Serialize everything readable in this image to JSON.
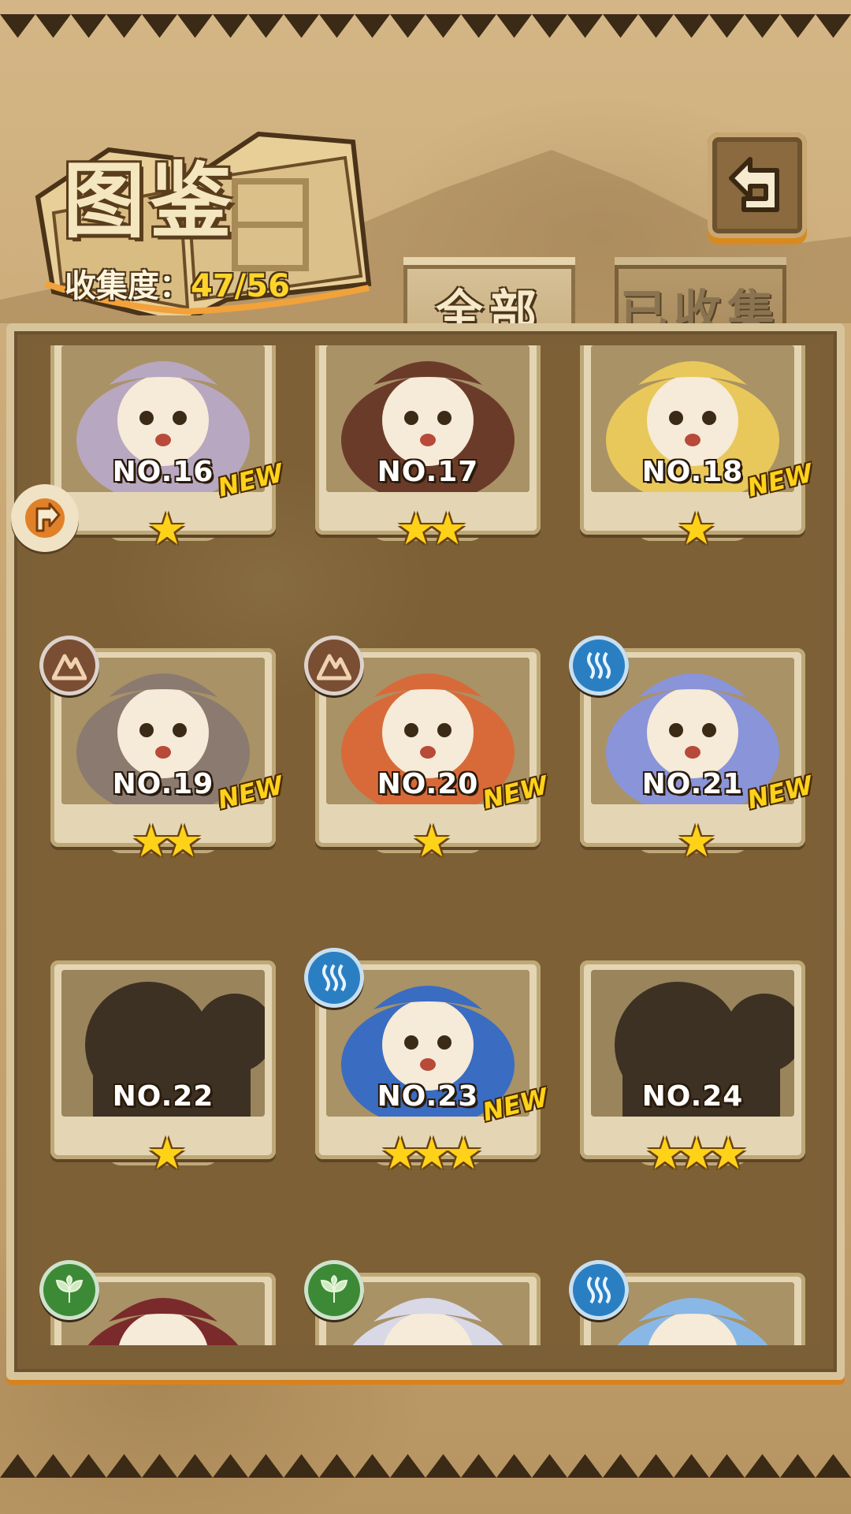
{
  "header": {
    "title": "图鉴",
    "collection_label": "收集度：",
    "collection_count": "47/56"
  },
  "tabs": [
    {
      "label": "全部",
      "active": true
    },
    {
      "label": "已收集",
      "active": false
    }
  ],
  "cards": [
    {
      "no": "NO.16",
      "stars": 1,
      "new": true,
      "element": null
    },
    {
      "no": "NO.17",
      "stars": 2,
      "new": false,
      "element": null
    },
    {
      "no": "NO.18",
      "stars": 1,
      "new": true,
      "element": null
    },
    {
      "no": "NO.19",
      "stars": 2,
      "new": true,
      "element": "earth"
    },
    {
      "no": "NO.20",
      "stars": 1,
      "new": true,
      "element": "earth"
    },
    {
      "no": "NO.21",
      "stars": 1,
      "new": true,
      "element": "water"
    },
    {
      "no": "NO.22",
      "stars": 1,
      "new": false,
      "element": null,
      "locked": true
    },
    {
      "no": "NO.23",
      "stars": 3,
      "new": true,
      "element": "water"
    },
    {
      "no": "NO.24",
      "stars": 3,
      "new": false,
      "element": null,
      "locked": true
    },
    {
      "no": "",
      "stars": 0,
      "new": false,
      "element": "leaf"
    },
    {
      "no": "",
      "stars": 0,
      "new": false,
      "element": "leaf"
    },
    {
      "no": "",
      "stars": 0,
      "new": false,
      "element": "water"
    }
  ],
  "labels": {
    "new": "NEW",
    "star": "★"
  },
  "icons": {
    "back": "back-arrow-icon",
    "side": "side-arrow-icon"
  },
  "colors": {
    "accent_yellow": "#ffd21a",
    "panel": "#7d6035",
    "water": "#2a7fc2",
    "earth": "#7a4e33",
    "leaf": "#3c8a36"
  }
}
